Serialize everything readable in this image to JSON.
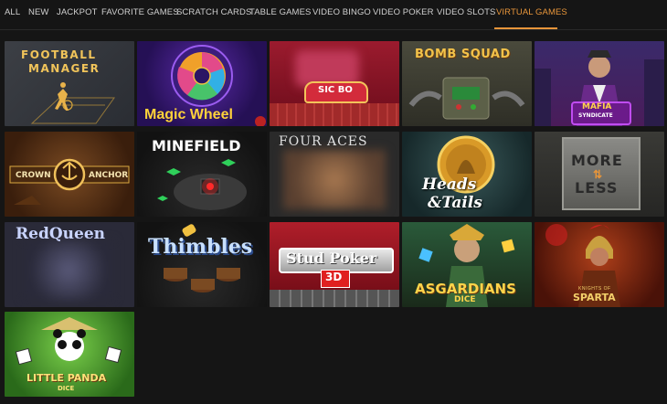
{
  "nav": {
    "tabs": [
      {
        "label": "ALL"
      },
      {
        "label": "NEW"
      },
      {
        "label": "JACKPOT"
      },
      {
        "label": "FAVORITE GAMES"
      },
      {
        "label": "SCRATCH CARDS"
      },
      {
        "label": "TABLE GAMES"
      },
      {
        "label": "VIDEO BINGO"
      },
      {
        "label": "VIDEO POKER"
      },
      {
        "label": "VIDEO SLOTS"
      },
      {
        "label": "VIRTUAL GAMES"
      }
    ],
    "active": "VIRTUAL GAMES"
  },
  "games": [
    {
      "title_line1": "FOOTBALL",
      "title_line2": "MANAGER"
    },
    {
      "title": "Magic Wheel"
    },
    {
      "title": "SIC BO"
    },
    {
      "title": "BOMB SQUAD"
    },
    {
      "title_line1": "MAFIA",
      "title_line2": "SYNDICATE"
    },
    {
      "title_left": "CROWN",
      "title_right": "ANCHOR"
    },
    {
      "title": "MINEFIELD"
    },
    {
      "title": "FOUR ACES"
    },
    {
      "title_line1": "Heads",
      "title_line2": "&Tails"
    },
    {
      "title_line1": "MORE",
      "title_line2": "LESS"
    },
    {
      "title": "RedQueen"
    },
    {
      "title": "Thimbles"
    },
    {
      "title": "Stud Poker",
      "badge": "3D"
    },
    {
      "title": "ASGARDIANS",
      "subtitle": "DICE"
    },
    {
      "title": "SPARTA",
      "subtitle": "KNIGHTS OF"
    },
    {
      "title_line1": "LITTLE PANDA",
      "title_line2": "DICE"
    }
  ],
  "colors": {
    "accent": "#e7953a",
    "background": "#151515"
  }
}
